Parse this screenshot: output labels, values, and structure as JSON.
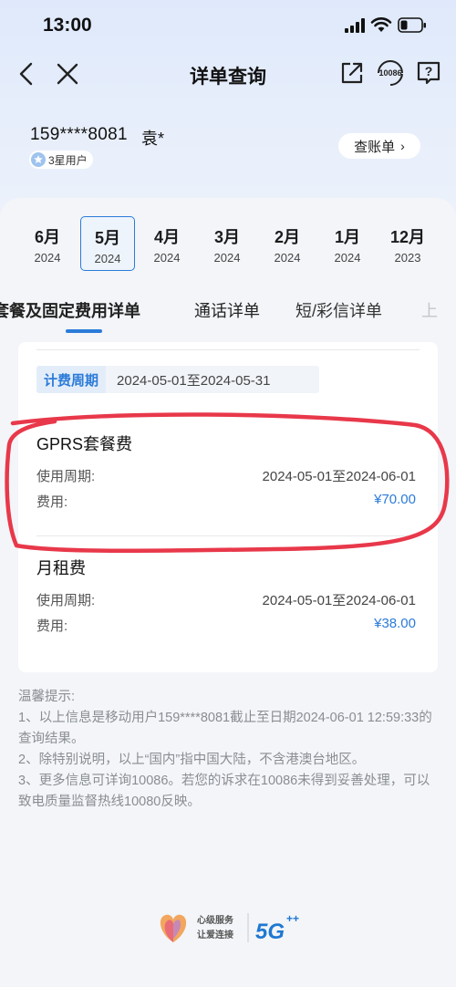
{
  "status": {
    "time": "13:00"
  },
  "nav": {
    "title": "详单查询",
    "hotline": "10086"
  },
  "user": {
    "phone": "159****8081",
    "name": "袁*",
    "level": "3星用户",
    "bill_button": "查账单",
    "bill_chevron": "›"
  },
  "months": [
    {
      "month": "6月",
      "year": "2024"
    },
    {
      "month": "5月",
      "year": "2024"
    },
    {
      "month": "4月",
      "year": "2024"
    },
    {
      "month": "3月",
      "year": "2024"
    },
    {
      "month": "2月",
      "year": "2024"
    },
    {
      "month": "1月",
      "year": "2024"
    },
    {
      "month": "12月",
      "year": "2023"
    }
  ],
  "selected_month_index": 1,
  "tabs": [
    "套餐及固定费用详单",
    "通话详单",
    "短/彩信详单",
    "上"
  ],
  "billing": {
    "period_label": "计费周期",
    "period_value": "2024-05-01至2024-05-31"
  },
  "items": [
    {
      "title": "GPRS套餐费",
      "period_label": "使用周期:",
      "period_value": "2024-05-01至2024-06-01",
      "fee_label": "费用:",
      "fee_value": "¥70.00"
    },
    {
      "title": "月租费",
      "period_label": "使用周期:",
      "period_value": "2024-05-01至2024-06-01",
      "fee_label": "费用:",
      "fee_value": "¥38.00"
    }
  ],
  "tips": [
    "温馨提示:",
    "1、以上信息是移动用户159****8081截止至日期2024-06-01 12:59:33的查询结果。",
    "2、除特别说明，以上“国内”指中国大陆，不含港澳台地区。",
    "3、更多信息可详询10086。若您的诉求在10086未得到妥善处理，可以致电质量监督热线10080反映。"
  ],
  "footer": {
    "slogan_line1": "心级服务",
    "slogan_line2": "让爱连接",
    "network": "5G"
  },
  "colors": {
    "accent": "#2b7bd9",
    "annotation": "#e8384a"
  }
}
